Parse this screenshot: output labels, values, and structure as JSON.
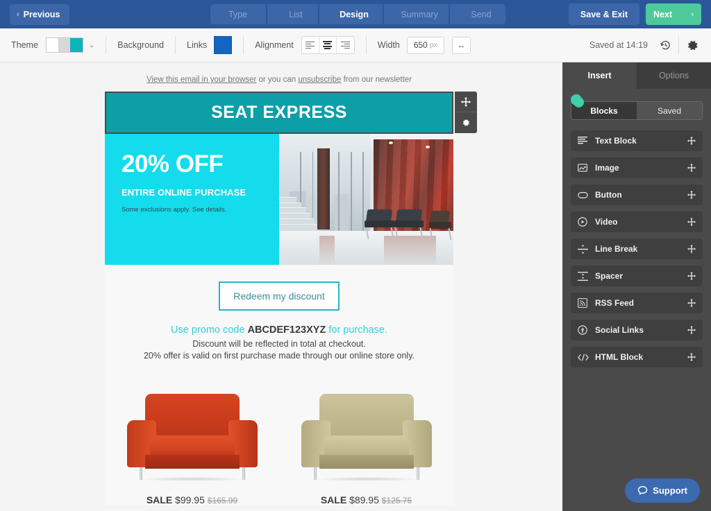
{
  "topbar": {
    "previous_label": "Previous",
    "previous_chevron": "‹",
    "steps": [
      {
        "label": "Type",
        "active": false
      },
      {
        "label": "List",
        "active": false
      },
      {
        "label": "Design",
        "active": true
      },
      {
        "label": "Summary",
        "active": false
      },
      {
        "label": "Send",
        "active": false
      }
    ],
    "save_exit_label": "Save & Exit",
    "next_label": "Next",
    "next_chevron": "›",
    "bg_color": "#2b5799",
    "step_color": "#3c66a8",
    "next_color": "#4dc99a"
  },
  "toolbar": {
    "theme_label": "Theme",
    "theme_swatch_colors": [
      "#ffffff",
      "#d8d8d8",
      "#0fb3bd"
    ],
    "theme_chevron": "⌄",
    "background_label": "Background",
    "links_label": "Links",
    "links_color": "#1565c0",
    "alignment_label": "Alignment",
    "alignment_selected": "center",
    "width_label": "Width",
    "width_value": "650",
    "width_unit": "px",
    "resize_icon": "↔",
    "saved_status": "Saved at 14:19"
  },
  "email": {
    "preheader": {
      "link1": "View this email in your browser",
      "mid": " or you can ",
      "link2": "unsubscribe",
      "tail": " from our newsletter"
    },
    "header": {
      "brand": "SEAT EXPRESS",
      "bg_color": "#0d9fa8"
    },
    "promo": {
      "headline": "20% OFF",
      "subhead": "ENTIRE ONLINE PURCHASE",
      "fineprint": "Some exclusions apply. See details.",
      "bg_color": "#14dced"
    },
    "cta": {
      "label": "Redeem my discount",
      "border_color": "#22b8c4"
    },
    "promo_text": {
      "line1_pre": "Use promo code ",
      "line1_code": "ABCDEF123XYZ",
      "line1_post": " for purchase.",
      "line2": "Discount will be reflected in total at checkout.",
      "line3": "20% offer is valid on first purchase made through our online store only.",
      "accent_color": "#2ad2e0"
    },
    "products": [
      {
        "sale_label": "SALE",
        "price": "$99.95",
        "old_price": "$165.99",
        "color": "#c8381d"
      },
      {
        "sale_label": "SALE",
        "price": "$89.95",
        "old_price": "$125.75",
        "color": "#bdb68c"
      }
    ]
  },
  "sidebar": {
    "tabs": [
      {
        "label": "Insert",
        "active": true
      },
      {
        "label": "Options",
        "active": false
      }
    ],
    "segments": [
      {
        "label": "Blocks",
        "selected": true
      },
      {
        "label": "Saved",
        "selected": false
      }
    ],
    "blocks": [
      {
        "label": "Text Block",
        "icon": "text-lines-icon"
      },
      {
        "label": "Image",
        "icon": "image-icon"
      },
      {
        "label": "Button",
        "icon": "button-icon"
      },
      {
        "label": "Video",
        "icon": "play-circle-icon"
      },
      {
        "label": "Line Break",
        "icon": "line-break-icon"
      },
      {
        "label": "Spacer",
        "icon": "spacer-icon"
      },
      {
        "label": "RSS Feed",
        "icon": "rss-icon"
      },
      {
        "label": "Social Links",
        "icon": "social-icon"
      },
      {
        "label": "HTML Block",
        "icon": "code-icon"
      }
    ],
    "bg_color": "#4a4a4a"
  },
  "support": {
    "label": "Support",
    "color": "#3b6ab0"
  }
}
